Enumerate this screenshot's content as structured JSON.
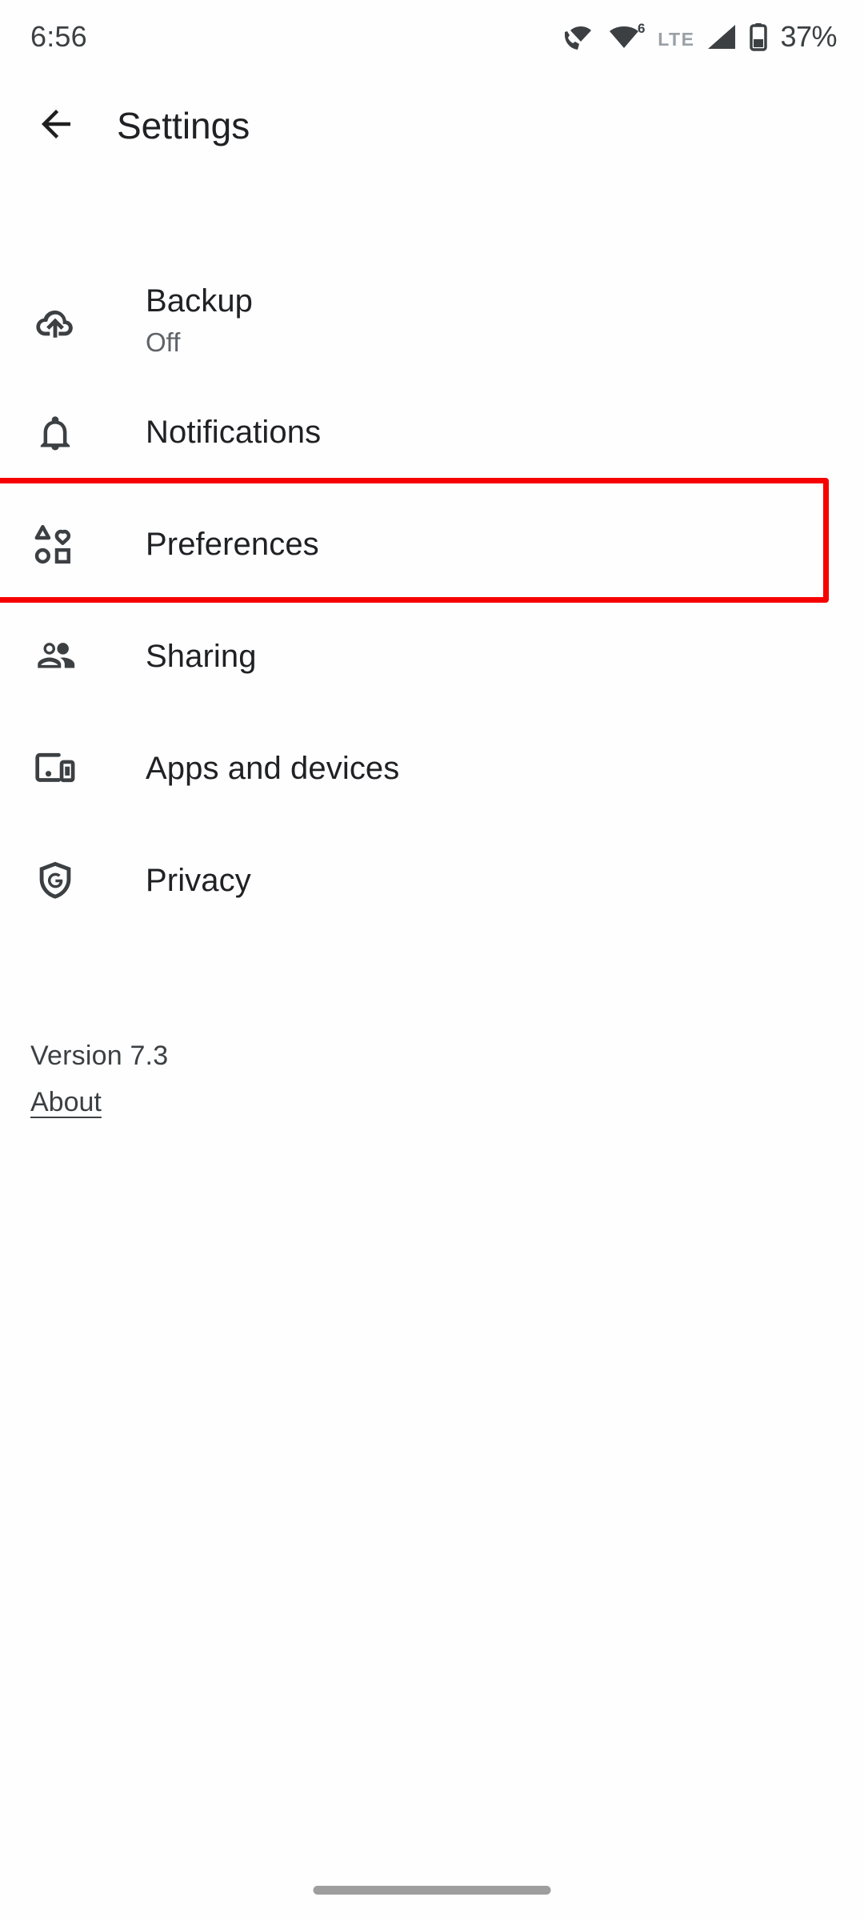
{
  "status_bar": {
    "time": "6:56",
    "network_type": "LTE",
    "battery_percent": "37%",
    "icons": [
      "vowifi-call-icon",
      "wifi-6-icon",
      "cellular-signal-icon",
      "battery-icon"
    ],
    "wifi_generation": "6"
  },
  "app_bar": {
    "back_icon": "arrow-back-icon",
    "title": "Settings"
  },
  "settings_rows": [
    {
      "label": "Backup",
      "subtitle": "Off",
      "icon": "cloud-upload-icon",
      "highlighted": false
    },
    {
      "label": "Notifications",
      "subtitle": "",
      "icon": "bell-icon",
      "highlighted": false
    },
    {
      "label": "Preferences",
      "subtitle": "",
      "icon": "shapes-grid-icon",
      "highlighted": true
    },
    {
      "label": "Sharing",
      "subtitle": "",
      "icon": "people-icon",
      "highlighted": false
    },
    {
      "label": "Apps and devices",
      "subtitle": "",
      "icon": "devices-icon",
      "highlighted": false
    },
    {
      "label": "Privacy",
      "subtitle": "",
      "icon": "shield-google-icon",
      "highlighted": false
    }
  ],
  "footer": {
    "version": "Version 7.3",
    "about_link": "About"
  },
  "colors": {
    "highlight_box": "#f60000",
    "background": "#fefefe",
    "primary_text": "#202124",
    "secondary_text": "#5f6368",
    "icon": "#3c4043"
  },
  "navigation": {
    "gesture_pill": "home-gesture-pill"
  }
}
